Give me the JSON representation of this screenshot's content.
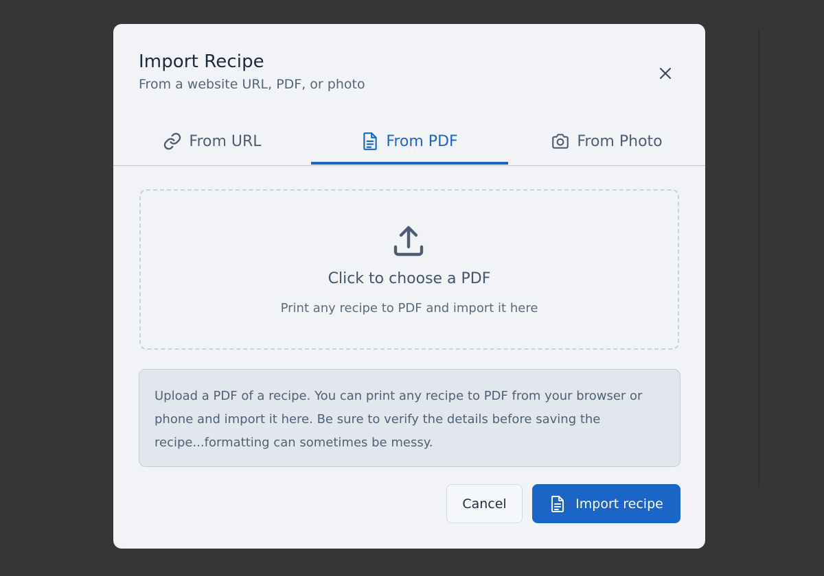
{
  "dialog": {
    "title": "Import Recipe",
    "subtitle": "From a website URL, PDF, or photo"
  },
  "tabs": [
    {
      "label": "From URL",
      "icon": "link-icon",
      "active": false
    },
    {
      "label": "From PDF",
      "icon": "document-icon",
      "active": true
    },
    {
      "label": "From Photo",
      "icon": "camera-icon",
      "active": false
    }
  ],
  "dropzone": {
    "icon": "upload-icon",
    "title": "Click to choose a PDF",
    "subtitle": "Print any recipe to PDF and import it here"
  },
  "info": {
    "text": "Upload a PDF of a recipe. You can print any recipe to PDF from your browser or phone and import it here. Be sure to verify the details before saving the recipe...formatting can sometimes be messy."
  },
  "actions": {
    "cancel_label": "Cancel",
    "import_label": "Import recipe",
    "import_icon": "document-icon"
  },
  "colors": {
    "accent": "#1b65c7",
    "backdrop": "#363636",
    "surface": "#f1f3f7"
  }
}
